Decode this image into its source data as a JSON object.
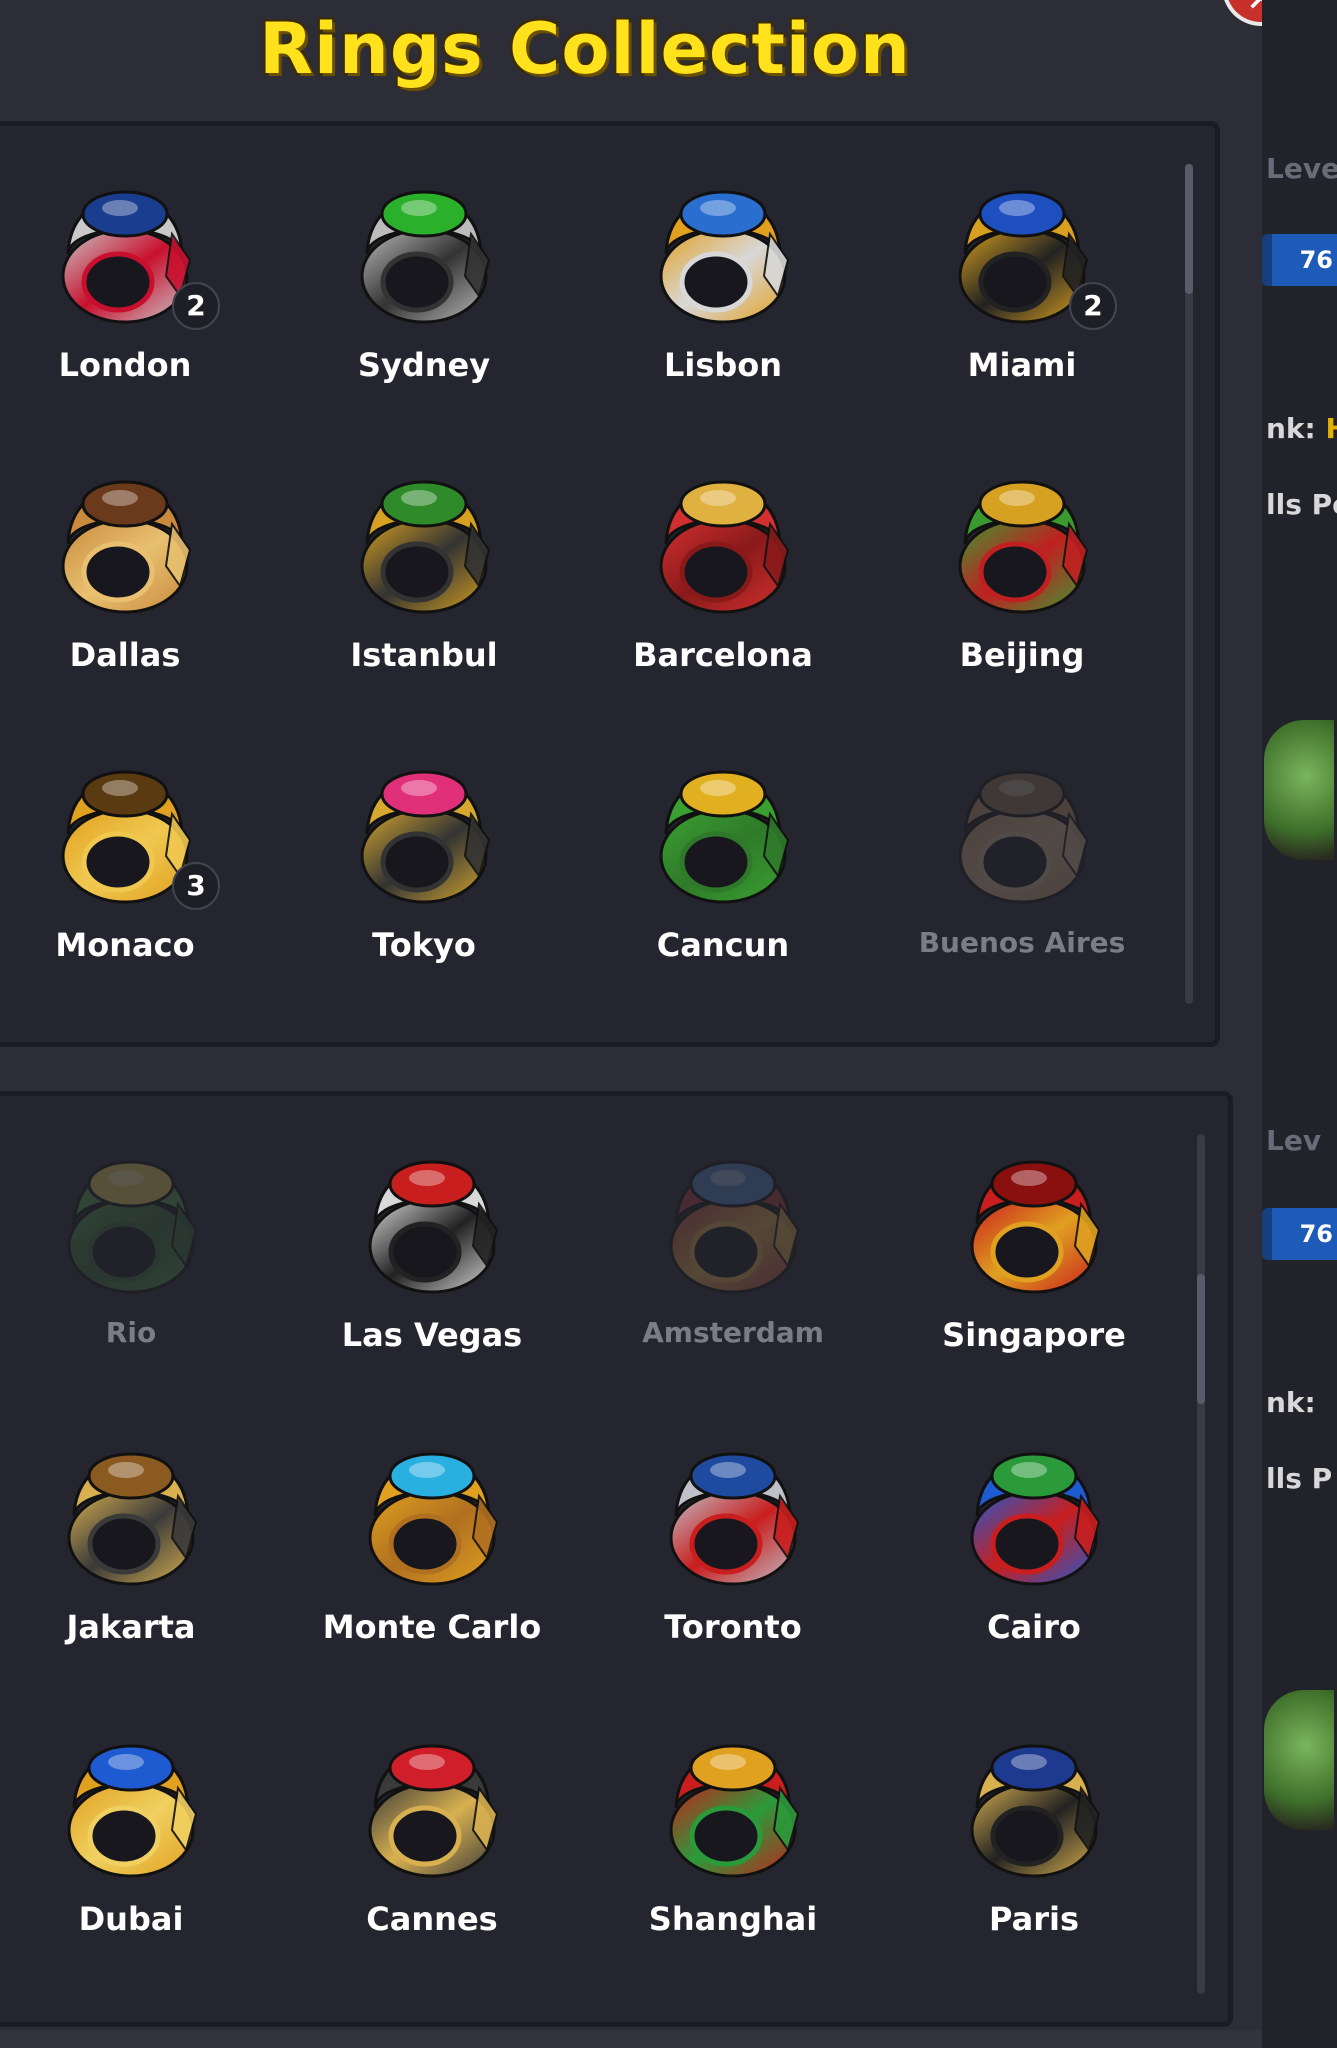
{
  "title": "Rings Collection",
  "close_icon": "close-x-icon",
  "right_strip": {
    "level_label_1": "Leve",
    "level_value_1": "76",
    "rank_label_1": "nk:",
    "rank_value_1": "H",
    "balls_label_1": "lls Po",
    "level_label_2": "Lev",
    "level_value_2": "76",
    "rank_label_2": "nk:",
    "balls_label_2": "lls P"
  },
  "panel_top": {
    "rings": [
      {
        "name": "London",
        "count": "2",
        "locked": false,
        "colors": [
          "#c9c9c9",
          "#1b3d8f",
          "#c8102e"
        ]
      },
      {
        "name": "Sydney",
        "count": "",
        "locked": false,
        "colors": [
          "#bcbcbc",
          "#2bb02b",
          "#333333"
        ]
      },
      {
        "name": "Lisbon",
        "count": "",
        "locked": false,
        "colors": [
          "#e2a020",
          "#2a6fd0",
          "#d8d8d8"
        ]
      },
      {
        "name": "Miami",
        "count": "2",
        "locked": false,
        "colors": [
          "#d8a020",
          "#1e4fbf",
          "#222222"
        ]
      },
      {
        "name": "Dallas",
        "count": "",
        "locked": false,
        "colors": [
          "#c98a3c",
          "#6b3a1c",
          "#e8c070"
        ]
      },
      {
        "name": "Istanbul",
        "count": "",
        "locked": false,
        "colors": [
          "#d6a020",
          "#2f8a2a",
          "#333333"
        ]
      },
      {
        "name": "Barcelona",
        "count": "",
        "locked": false,
        "colors": [
          "#d23030",
          "#e0b040",
          "#8a1a1a"
        ]
      },
      {
        "name": "Beijing",
        "count": "",
        "locked": false,
        "colors": [
          "#3a9a30",
          "#d6a020",
          "#c02020"
        ]
      },
      {
        "name": "Monaco",
        "count": "3",
        "locked": false,
        "colors": [
          "#e0a020",
          "#5a3a10",
          "#f0c850"
        ]
      },
      {
        "name": "Tokyo",
        "count": "",
        "locked": false,
        "colors": [
          "#d6a830",
          "#e0307a",
          "#333333"
        ]
      },
      {
        "name": "Cancun",
        "count": "",
        "locked": false,
        "colors": [
          "#3aa030",
          "#e0b020",
          "#2f7a2a"
        ]
      },
      {
        "name": "Buenos Aires",
        "count": "",
        "locked": true,
        "colors": [
          "#c08a50",
          "#8a6a40",
          "#d0a870"
        ]
      }
    ]
  },
  "panel_bottom": {
    "rings": [
      {
        "name": "Rio",
        "count": "",
        "locked": true,
        "colors": [
          "#3a9a30",
          "#e0c020",
          "#2a6a2a"
        ]
      },
      {
        "name": "Las Vegas",
        "count": "",
        "locked": false,
        "colors": [
          "#d8d8d8",
          "#c81e1e",
          "#222222"
        ]
      },
      {
        "name": "Amsterdam",
        "count": "",
        "locked": true,
        "colors": [
          "#c83030",
          "#3a7ad0",
          "#e0a020"
        ]
      },
      {
        "name": "Singapore",
        "count": "",
        "locked": false,
        "colors": [
          "#c81e1e",
          "#8a1010",
          "#e0a020"
        ]
      },
      {
        "name": "Jakarta",
        "count": "",
        "locked": false,
        "colors": [
          "#d8b050",
          "#8a5a20",
          "#3a3a3a"
        ]
      },
      {
        "name": "Monte Carlo",
        "count": "",
        "locked": false,
        "colors": [
          "#e0a020",
          "#2ab0e0",
          "#b07020"
        ]
      },
      {
        "name": "Toronto",
        "count": "",
        "locked": false,
        "colors": [
          "#c0c0c8",
          "#1e4aa0",
          "#c81e1e"
        ]
      },
      {
        "name": "Cairo",
        "count": "",
        "locked": false,
        "colors": [
          "#1e5ad0",
          "#2a9a3a",
          "#c81e1e"
        ]
      },
      {
        "name": "Dubai",
        "count": "",
        "locked": false,
        "colors": [
          "#e0a020",
          "#1e5ad0",
          "#f0d060"
        ]
      },
      {
        "name": "Cannes",
        "count": "",
        "locked": false,
        "colors": [
          "#3a3a3a",
          "#d01e2a",
          "#d8b050"
        ]
      },
      {
        "name": "Shanghai",
        "count": "",
        "locked": false,
        "colors": [
          "#c81e1e",
          "#e0a020",
          "#2a9a3a"
        ]
      },
      {
        "name": "Paris",
        "count": "",
        "locked": false,
        "colors": [
          "#d8b050",
          "#1e3a90",
          "#222222"
        ]
      }
    ]
  }
}
